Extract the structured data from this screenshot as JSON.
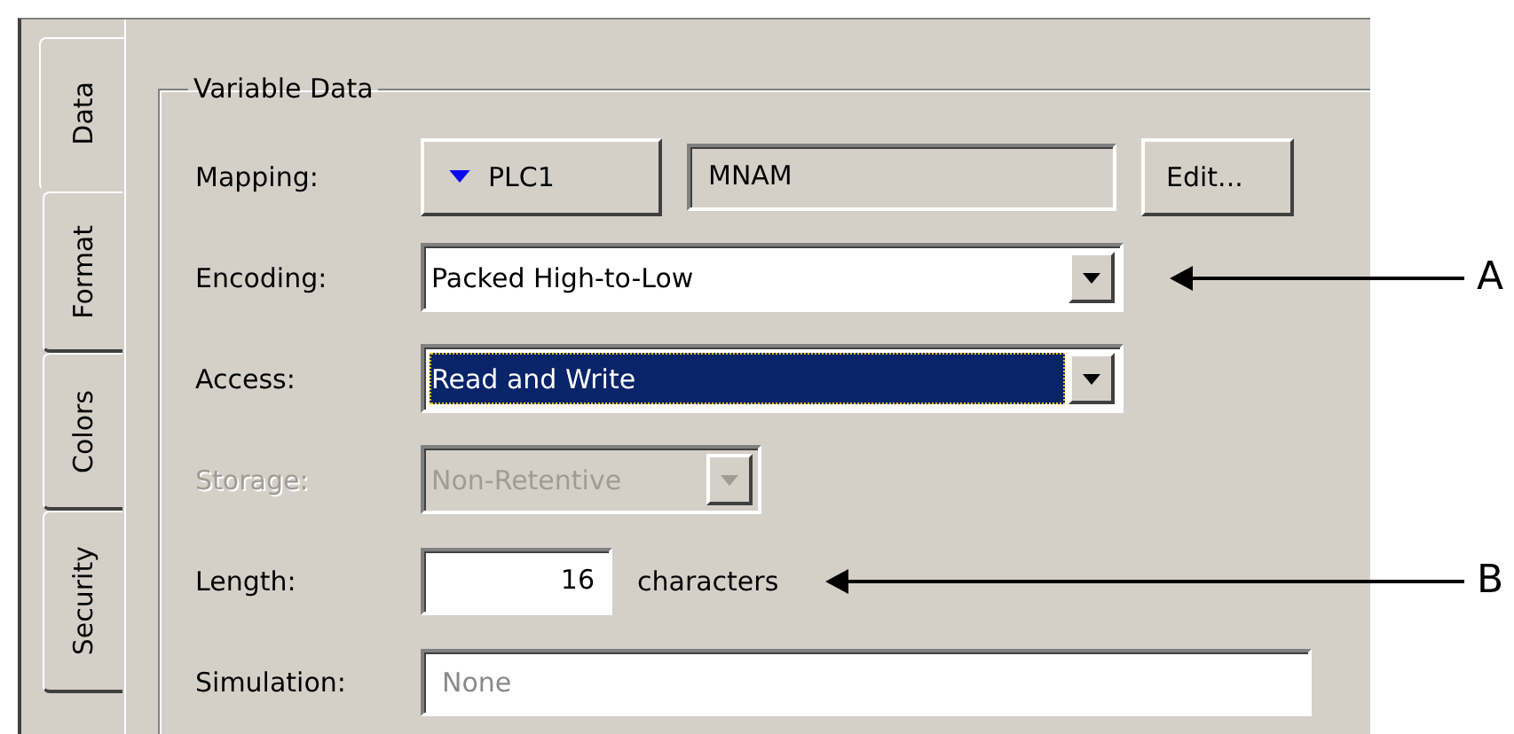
{
  "tabs": [
    {
      "label": "Data",
      "selected": true
    },
    {
      "label": "Format",
      "selected": false
    },
    {
      "label": "Colors",
      "selected": false
    },
    {
      "label": "Security",
      "selected": false
    }
  ],
  "group": {
    "title": "Variable Data",
    "rows": [
      {
        "kind": "mapping",
        "label": "Mapping:",
        "device": "PLC1",
        "address": "MNAM",
        "button": "Edit..."
      },
      {
        "kind": "combo",
        "label": "Encoding:",
        "value": "Packed High-to-Low",
        "focused": false,
        "disabled": false,
        "callout": "A"
      },
      {
        "kind": "combo",
        "label": "Access:",
        "value": "Read and Write",
        "focused": true,
        "disabled": false
      },
      {
        "kind": "combo",
        "label": "Storage:",
        "value": "Non-Retentive",
        "focused": false,
        "disabled": true
      },
      {
        "kind": "number",
        "label": "Length:",
        "value": "16",
        "unit": "characters",
        "callout": "B"
      },
      {
        "kind": "text",
        "label": "Simulation:",
        "placeholder": "None"
      }
    ]
  }
}
